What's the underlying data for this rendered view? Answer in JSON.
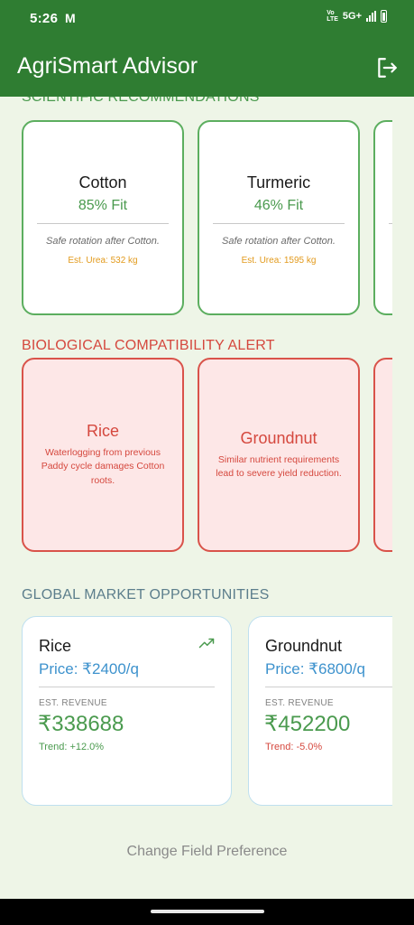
{
  "status_bar": {
    "time": "5:26",
    "carrier_icon": "M",
    "network": "5G+",
    "volte": "Vo\nLTE"
  },
  "app": {
    "title": "AgriSmart Advisor",
    "logout_icon": "logout-icon"
  },
  "recommendations": {
    "title": "SCIENTIFIC RECOMMENDATIONS",
    "cards": [
      {
        "crop": "Cotton",
        "fit": "85% Fit",
        "note": "Safe rotation after Cotton.",
        "urea": "Est. Urea: 532 kg"
      },
      {
        "crop": "Turmeric",
        "fit": "46% Fit",
        "note": "Safe rotation after Cotton.",
        "urea": "Est. Urea: 1595 kg"
      }
    ]
  },
  "alerts": {
    "title": "BIOLOGICAL COMPATIBILITY ALERT",
    "cards": [
      {
        "crop": "Rice",
        "reason": "Waterlogging from previous Paddy cycle damages Cotton roots."
      },
      {
        "crop": "Groundnut",
        "reason": "Similar nutrient requirements lead to severe yield reduction."
      }
    ]
  },
  "market": {
    "title": "GLOBAL MARKET OPPORTUNITIES",
    "cards": [
      {
        "crop": "Rice",
        "price": "Price: ₹2400/q",
        "revenue_label": "EST. REVENUE",
        "revenue": "₹338688",
        "trend": "Trend: +12.0%",
        "trend_dir": "up"
      },
      {
        "crop": "Groundnut",
        "price": "Price: ₹6800/q",
        "revenue_label": "EST. REVENUE",
        "revenue": "₹452200",
        "trend": "Trend: -5.0%",
        "trend_dir": "down"
      }
    ]
  },
  "footer": {
    "change_preference": "Change Field Preference"
  },
  "colors": {
    "primary": "#2f7d32",
    "background": "#eef5e7",
    "success": "#4a9a4e",
    "danger": "#d5483e",
    "warning": "#e29a1c",
    "info": "#3d92cd"
  }
}
